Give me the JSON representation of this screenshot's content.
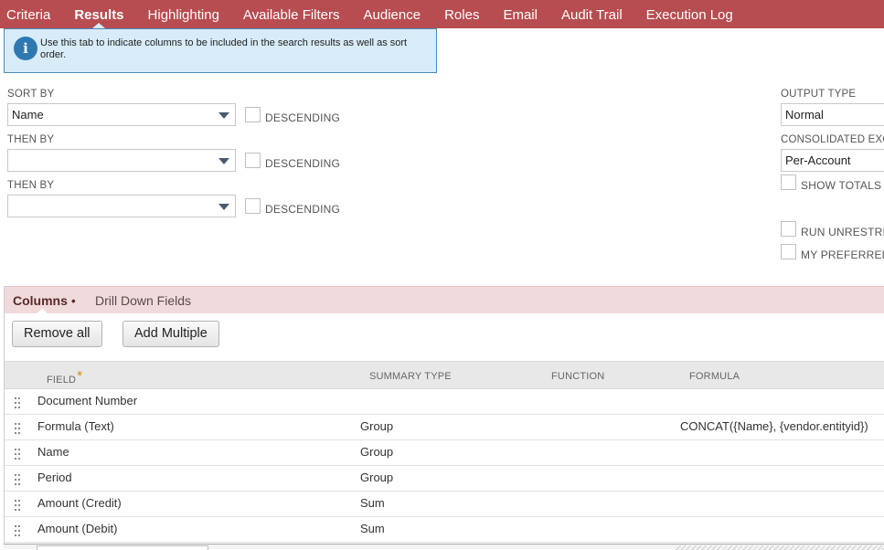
{
  "tabs": [
    {
      "label": "Criteria",
      "active": false
    },
    {
      "label": "Results",
      "active": true
    },
    {
      "label": "Highlighting",
      "active": false
    },
    {
      "label": "Available Filters",
      "active": false
    },
    {
      "label": "Audience",
      "active": false
    },
    {
      "label": "Roles",
      "active": false
    },
    {
      "label": "Email",
      "active": false
    },
    {
      "label": "Audit Trail",
      "active": false
    },
    {
      "label": "Execution Log",
      "active": false
    }
  ],
  "info": {
    "text": "Use this tab to indicate columns to be included in the search results as well as sort order."
  },
  "sort": {
    "sort_by_label": "SORT BY",
    "sort_by_value": "Name",
    "then_by_1_label": "THEN BY",
    "then_by_1_value": "",
    "then_by_2_label": "THEN BY",
    "then_by_2_value": "",
    "descending_label": "DESCENDING"
  },
  "options": {
    "output_type_label": "OUTPUT TYPE",
    "output_type_value": "Normal",
    "consolidated_label": "CONSOLIDATED EXC",
    "consolidated_value": "Per-Account",
    "show_totals_label": "SHOW TOTALS",
    "run_unrestricted_label": "RUN UNRESTRIC",
    "my_preferred_label": "MY PREFERRED S"
  },
  "subtabs": {
    "columns_label": "Columns",
    "columns_marker": "•",
    "drill_down_label": "Drill Down Fields"
  },
  "buttons": {
    "remove_all": "Remove all",
    "add_multiple": "Add Multiple"
  },
  "table": {
    "headers": {
      "field": "FIELD",
      "required_marker": "*",
      "summary_type": "SUMMARY TYPE",
      "function": "FUNCTION",
      "formula": "FORMULA"
    },
    "rows": [
      {
        "field": "Document Number",
        "summary_type": "",
        "function": "",
        "formula": ""
      },
      {
        "field": "Formula (Text)",
        "summary_type": "Group",
        "function": "",
        "formula": "CONCAT({Name}, {vendor.entityid})"
      },
      {
        "field": "Name",
        "summary_type": "Group",
        "function": "",
        "formula": ""
      },
      {
        "field": "Period",
        "summary_type": "Group",
        "function": "",
        "formula": ""
      },
      {
        "field": "Amount (Credit)",
        "summary_type": "Sum",
        "function": "",
        "formula": ""
      },
      {
        "field": "Amount (Debit)",
        "summary_type": "Sum",
        "function": "",
        "formula": ""
      }
    ]
  },
  "icons": {
    "info": "info-icon",
    "dropdown": "chevron-down-icon",
    "drag": "drag-handle-icon"
  },
  "colors": {
    "tabbar": "#b74d50",
    "info_bg": "#d7ecf8",
    "subtab_bg": "#f1dadb",
    "required": "#d78b00"
  }
}
